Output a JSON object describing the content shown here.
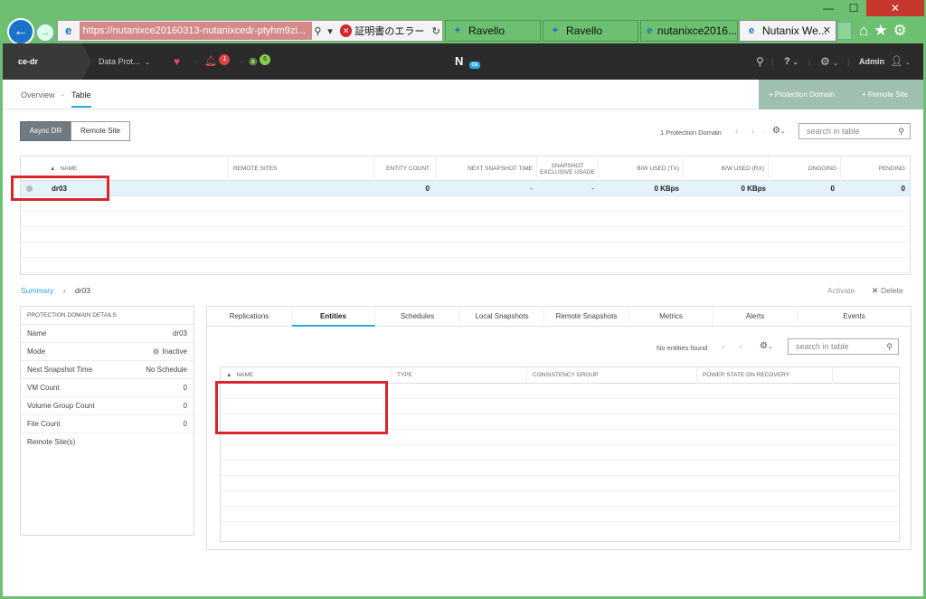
{
  "browser": {
    "url": "https://nutanixce20160313-nutanixcedr-ptyhm9zi...",
    "cert_error": "証明書のエラー",
    "tabs": [
      {
        "label": "Ravello"
      },
      {
        "label": "Ravello"
      },
      {
        "label": "nutanixce2016..."
      },
      {
        "label": "Nutanix We..."
      }
    ]
  },
  "topnav": {
    "cluster": "ce-dr",
    "menu": "Data Prot...",
    "alerts_count": "1",
    "tasks_count": "6",
    "user": "Admin",
    "help": "?"
  },
  "subnav": {
    "overview": "Overview",
    "sep": "·",
    "table": "Table",
    "add_protection_domain": "+ Protection Domain",
    "add_remote_site": "+ Remote Site"
  },
  "segments": {
    "async_dr": "Async DR",
    "remote_site": "Remote Site"
  },
  "pd_toolbar": {
    "count": "1 Protection Domain",
    "search_placeholder": "search in table"
  },
  "pd_table": {
    "columns": [
      "NAME",
      "REMOTE SITES",
      "ENTITY COUNT",
      "NEXT SNAPSHOT TIME",
      "SNAPSHOT EXCLUSIVE USAGE",
      "B/W USED (TX)",
      "B/W USED (RX)",
      "ONGOING",
      "PENDING"
    ],
    "rows": [
      {
        "name": "dr03",
        "remote_sites": "",
        "entity_count": "0",
        "next_snapshot": "-",
        "exclusive_usage": "-",
        "bw_tx": "0 KBps",
        "bw_rx": "0 KBps",
        "ongoing": "0",
        "pending": "0"
      }
    ]
  },
  "summary": {
    "label": "Summary",
    "arrow": "›",
    "name": "dr03",
    "activate": "Activate",
    "delete": "Delete"
  },
  "details": {
    "header": "PROTECTION DOMAIN DETAILS",
    "rows": [
      {
        "k": "Name",
        "v": "dr03"
      },
      {
        "k": "Mode",
        "v": "Inactive"
      },
      {
        "k": "Next Snapshot Time",
        "v": "No Schedule"
      },
      {
        "k": "VM Count",
        "v": "0"
      },
      {
        "k": "Volume Group Count",
        "v": "0"
      },
      {
        "k": "File Count",
        "v": "0"
      },
      {
        "k": "Remote Site(s)",
        "v": ""
      }
    ]
  },
  "tabs": [
    "Replications",
    "Entities",
    "Schedules",
    "Local Snapshots",
    "Remote Snapshots",
    "Metrics",
    "Alerts",
    "Events"
  ],
  "entities_toolbar": {
    "count": "No entities found",
    "search_placeholder": "search in table"
  },
  "entities_table": {
    "columns": [
      "NAME",
      "TYPE",
      "CONSISTENCY GROUP",
      "POWER STATE ON RECOVERY"
    ]
  }
}
